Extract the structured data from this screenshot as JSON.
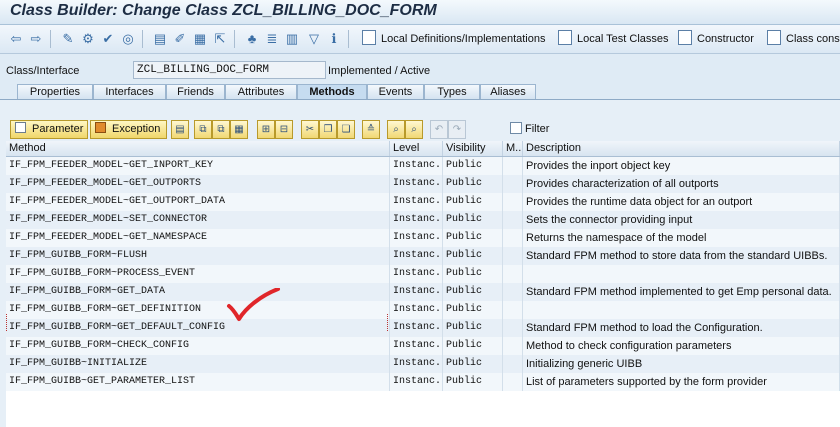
{
  "window": {
    "title": "Class Builder: Change Class ZCL_BILLING_DOC_FORM"
  },
  "toolbar": {
    "icons": [
      "back-arrow-icon",
      "forward-arrow-icon",
      "edit-toggle-icon",
      "activate-icon",
      "check-icon",
      "where-used-icon",
      "object-list-icon",
      "display-object-icon",
      "pattern-icon",
      "insert-icon",
      "hierarchy-icon",
      "pretty-printer-icon",
      "object-directory-icon",
      "filter-icon",
      "info-icon"
    ],
    "buttons": {
      "local_definitions": "Local Definitions/Implementations",
      "local_test_classes": "Local Test Classes",
      "constructor": "Constructor",
      "class_constructor": "Class constr"
    }
  },
  "class_info": {
    "label": "Class/Interface",
    "name": "ZCL_BILLING_DOC_FORM",
    "status": "Implemented / Active"
  },
  "tabs": [
    "Properties",
    "Interfaces",
    "Friends",
    "Attributes",
    "Methods",
    "Events",
    "Types",
    "Aliases"
  ],
  "active_tab": "Methods",
  "method_toolbar": {
    "parameter_label": "Parameter",
    "exception_label": "Exception",
    "filter_label": "Filter",
    "filter_checked": false
  },
  "table": {
    "columns": [
      "Method",
      "Level",
      "Visibility",
      "M...",
      "Description"
    ],
    "rows": [
      {
        "method": "IF_FPM_FEEDER_MODEL~GET_INPORT_KEY",
        "level": "Instanc...",
        "visibility": "Public",
        "m": "",
        "description": "Provides the inport object key"
      },
      {
        "method": "IF_FPM_FEEDER_MODEL~GET_OUTPORTS",
        "level": "Instanc...",
        "visibility": "Public",
        "m": "",
        "description": "Provides characterization of all outports"
      },
      {
        "method": "IF_FPM_FEEDER_MODEL~GET_OUTPORT_DATA",
        "level": "Instanc...",
        "visibility": "Public",
        "m": "",
        "description": "Provides the runtime data object for an outport"
      },
      {
        "method": "IF_FPM_FEEDER_MODEL~SET_CONNECTOR",
        "level": "Instanc...",
        "visibility": "Public",
        "m": "",
        "description": "Sets the connector providing input"
      },
      {
        "method": "IF_FPM_FEEDER_MODEL~GET_NAMESPACE",
        "level": "Instanc...",
        "visibility": "Public",
        "m": "",
        "description": "Returns the namespace of the model"
      },
      {
        "method": "IF_FPM_GUIBB_FORM~FLUSH",
        "level": "Instanc...",
        "visibility": "Public",
        "m": "",
        "description": "Standard FPM method to store data from the standard UIBBs."
      },
      {
        "method": "IF_FPM_GUIBB_FORM~PROCESS_EVENT",
        "level": "Instanc...",
        "visibility": "Public",
        "m": "",
        "description": ""
      },
      {
        "method": "IF_FPM_GUIBB_FORM~GET_DATA",
        "level": "Instanc...",
        "visibility": "Public",
        "m": "",
        "description": "Standard FPM method implemented to get Emp personal data."
      },
      {
        "method": "IF_FPM_GUIBB_FORM~GET_DEFINITION",
        "level": "Instanc...",
        "visibility": "Public",
        "m": "",
        "description": ""
      },
      {
        "method": "IF_FPM_GUIBB_FORM~GET_DEFAULT_CONFIG",
        "level": "Instanc...",
        "visibility": "Public",
        "m": "",
        "description": "Standard FPM method to load the Configuration."
      },
      {
        "method": "IF_FPM_GUIBB_FORM~CHECK_CONFIG",
        "level": "Instanc...",
        "visibility": "Public",
        "m": "",
        "description": "Method to check configuration parameters"
      },
      {
        "method": "IF_FPM_GUIBB~INITIALIZE",
        "level": "Instanc...",
        "visibility": "Public",
        "m": "",
        "description": "Initializing generic UIBB"
      },
      {
        "method": "IF_FPM_GUIBB~GET_PARAMETER_LIST",
        "level": "Instanc...",
        "visibility": "Public",
        "m": "",
        "description": "List of parameters supported by the form provider"
      }
    ]
  },
  "annotation": {
    "color": "#e0262a"
  }
}
